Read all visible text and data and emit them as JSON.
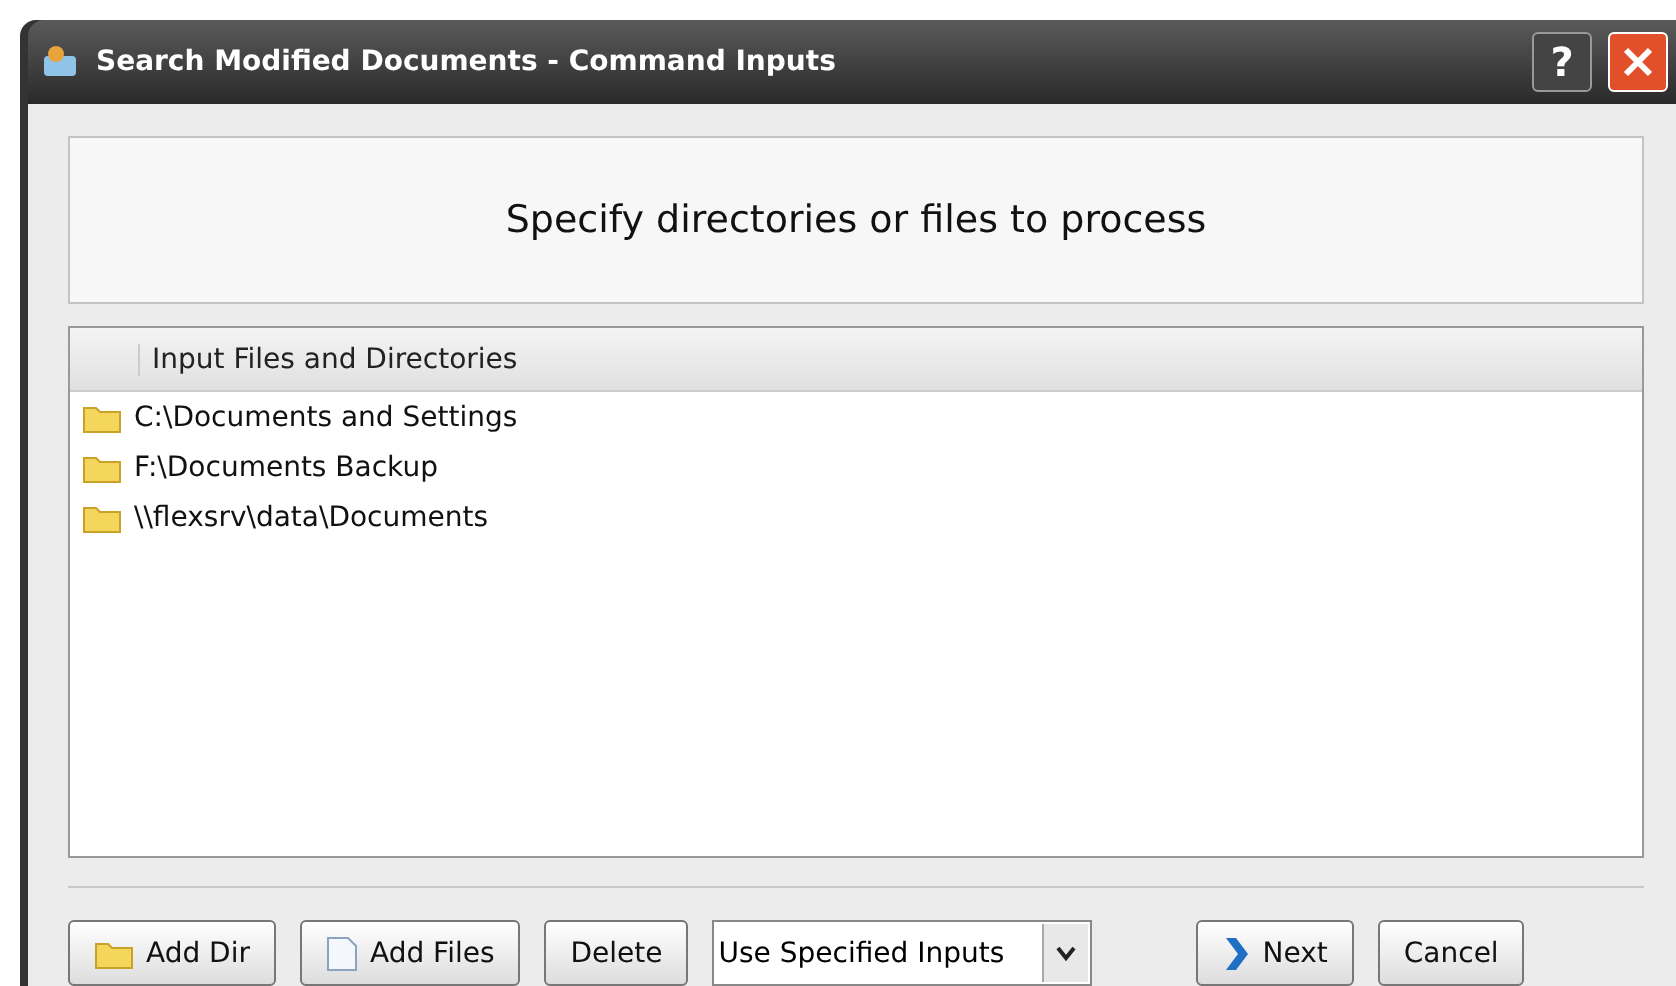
{
  "window": {
    "title": "Search Modified Documents - Command Inputs",
    "help_button": "?"
  },
  "heading": "Specify directories or files to process",
  "list": {
    "column": "Input Files and Directories",
    "items": [
      {
        "path": "C:\\Documents and Settings"
      },
      {
        "path": "F:\\Documents Backup"
      },
      {
        "path": "\\\\flexsrv\\data\\Documents"
      }
    ]
  },
  "buttons": [
    {
      "kind": "folder",
      "label": "Add Dir"
    },
    {
      "kind": "file",
      "label": "Add Files"
    },
    {
      "kind": "plain",
      "label": "Delete"
    }
  ],
  "mode_dropdown": {
    "value": "Use Specified Inputs"
  },
  "nav_buttons": [
    {
      "kind": "next",
      "label": "Next"
    },
    {
      "kind": "plain",
      "label": "Cancel"
    }
  ]
}
